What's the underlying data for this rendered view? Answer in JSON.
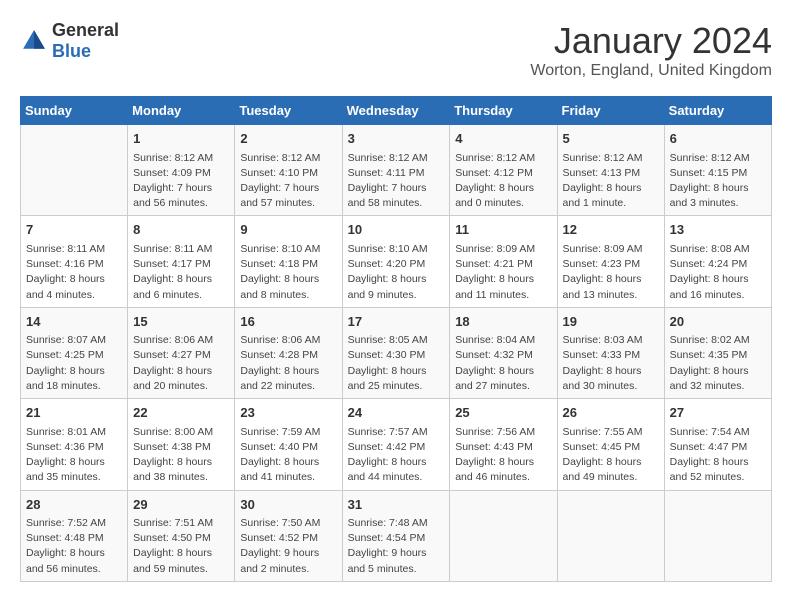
{
  "header": {
    "logo_general": "General",
    "logo_blue": "Blue",
    "title": "January 2024",
    "location": "Worton, England, United Kingdom"
  },
  "days_of_week": [
    "Sunday",
    "Monday",
    "Tuesday",
    "Wednesday",
    "Thursday",
    "Friday",
    "Saturday"
  ],
  "weeks": [
    [
      {
        "day": "",
        "info": ""
      },
      {
        "day": "1",
        "info": "Sunrise: 8:12 AM\nSunset: 4:09 PM\nDaylight: 7 hours\nand 56 minutes."
      },
      {
        "day": "2",
        "info": "Sunrise: 8:12 AM\nSunset: 4:10 PM\nDaylight: 7 hours\nand 57 minutes."
      },
      {
        "day": "3",
        "info": "Sunrise: 8:12 AM\nSunset: 4:11 PM\nDaylight: 7 hours\nand 58 minutes."
      },
      {
        "day": "4",
        "info": "Sunrise: 8:12 AM\nSunset: 4:12 PM\nDaylight: 8 hours\nand 0 minutes."
      },
      {
        "day": "5",
        "info": "Sunrise: 8:12 AM\nSunset: 4:13 PM\nDaylight: 8 hours\nand 1 minute."
      },
      {
        "day": "6",
        "info": "Sunrise: 8:12 AM\nSunset: 4:15 PM\nDaylight: 8 hours\nand 3 minutes."
      }
    ],
    [
      {
        "day": "7",
        "info": "Sunrise: 8:11 AM\nSunset: 4:16 PM\nDaylight: 8 hours\nand 4 minutes."
      },
      {
        "day": "8",
        "info": "Sunrise: 8:11 AM\nSunset: 4:17 PM\nDaylight: 8 hours\nand 6 minutes."
      },
      {
        "day": "9",
        "info": "Sunrise: 8:10 AM\nSunset: 4:18 PM\nDaylight: 8 hours\nand 8 minutes."
      },
      {
        "day": "10",
        "info": "Sunrise: 8:10 AM\nSunset: 4:20 PM\nDaylight: 8 hours\nand 9 minutes."
      },
      {
        "day": "11",
        "info": "Sunrise: 8:09 AM\nSunset: 4:21 PM\nDaylight: 8 hours\nand 11 minutes."
      },
      {
        "day": "12",
        "info": "Sunrise: 8:09 AM\nSunset: 4:23 PM\nDaylight: 8 hours\nand 13 minutes."
      },
      {
        "day": "13",
        "info": "Sunrise: 8:08 AM\nSunset: 4:24 PM\nDaylight: 8 hours\nand 16 minutes."
      }
    ],
    [
      {
        "day": "14",
        "info": "Sunrise: 8:07 AM\nSunset: 4:25 PM\nDaylight: 8 hours\nand 18 minutes."
      },
      {
        "day": "15",
        "info": "Sunrise: 8:06 AM\nSunset: 4:27 PM\nDaylight: 8 hours\nand 20 minutes."
      },
      {
        "day": "16",
        "info": "Sunrise: 8:06 AM\nSunset: 4:28 PM\nDaylight: 8 hours\nand 22 minutes."
      },
      {
        "day": "17",
        "info": "Sunrise: 8:05 AM\nSunset: 4:30 PM\nDaylight: 8 hours\nand 25 minutes."
      },
      {
        "day": "18",
        "info": "Sunrise: 8:04 AM\nSunset: 4:32 PM\nDaylight: 8 hours\nand 27 minutes."
      },
      {
        "day": "19",
        "info": "Sunrise: 8:03 AM\nSunset: 4:33 PM\nDaylight: 8 hours\nand 30 minutes."
      },
      {
        "day": "20",
        "info": "Sunrise: 8:02 AM\nSunset: 4:35 PM\nDaylight: 8 hours\nand 32 minutes."
      }
    ],
    [
      {
        "day": "21",
        "info": "Sunrise: 8:01 AM\nSunset: 4:36 PM\nDaylight: 8 hours\nand 35 minutes."
      },
      {
        "day": "22",
        "info": "Sunrise: 8:00 AM\nSunset: 4:38 PM\nDaylight: 8 hours\nand 38 minutes."
      },
      {
        "day": "23",
        "info": "Sunrise: 7:59 AM\nSunset: 4:40 PM\nDaylight: 8 hours\nand 41 minutes."
      },
      {
        "day": "24",
        "info": "Sunrise: 7:57 AM\nSunset: 4:42 PM\nDaylight: 8 hours\nand 44 minutes."
      },
      {
        "day": "25",
        "info": "Sunrise: 7:56 AM\nSunset: 4:43 PM\nDaylight: 8 hours\nand 46 minutes."
      },
      {
        "day": "26",
        "info": "Sunrise: 7:55 AM\nSunset: 4:45 PM\nDaylight: 8 hours\nand 49 minutes."
      },
      {
        "day": "27",
        "info": "Sunrise: 7:54 AM\nSunset: 4:47 PM\nDaylight: 8 hours\nand 52 minutes."
      }
    ],
    [
      {
        "day": "28",
        "info": "Sunrise: 7:52 AM\nSunset: 4:48 PM\nDaylight: 8 hours\nand 56 minutes."
      },
      {
        "day": "29",
        "info": "Sunrise: 7:51 AM\nSunset: 4:50 PM\nDaylight: 8 hours\nand 59 minutes."
      },
      {
        "day": "30",
        "info": "Sunrise: 7:50 AM\nSunset: 4:52 PM\nDaylight: 9 hours\nand 2 minutes."
      },
      {
        "day": "31",
        "info": "Sunrise: 7:48 AM\nSunset: 4:54 PM\nDaylight: 9 hours\nand 5 minutes."
      },
      {
        "day": "",
        "info": ""
      },
      {
        "day": "",
        "info": ""
      },
      {
        "day": "",
        "info": ""
      }
    ]
  ]
}
